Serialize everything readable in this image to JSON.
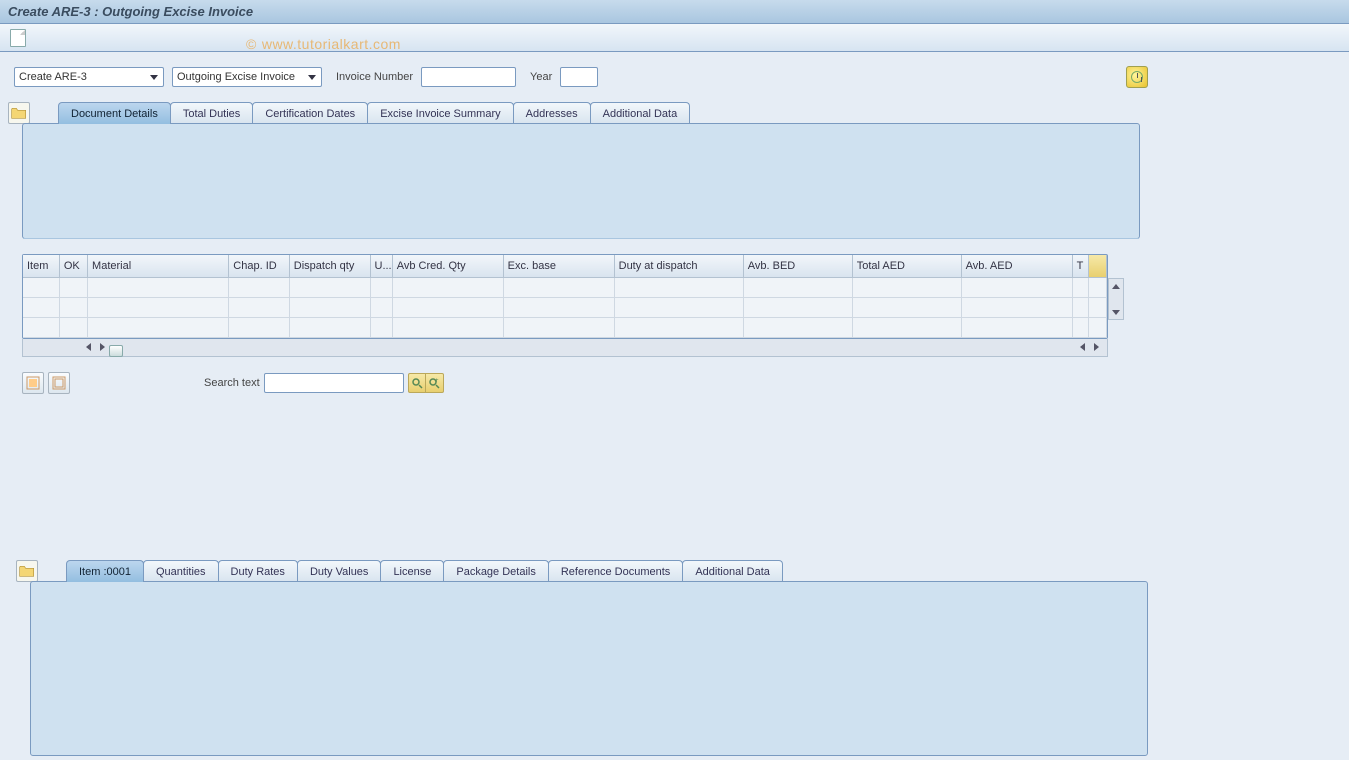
{
  "title": "Create ARE-3 : Outgoing Excise Invoice",
  "watermark": "www.tutorialkart.com",
  "filter": {
    "select1": "Create ARE-3",
    "select2": "Outgoing Excise Invoice",
    "invoice_label": "Invoice Number",
    "invoice_value": "",
    "year_label": "Year",
    "year_value": ""
  },
  "tabs1": [
    "Document Details",
    "Total Duties",
    "Certification Dates",
    "Excise Invoice Summary",
    "Addresses",
    "Additional Data"
  ],
  "tabs1_active": 0,
  "table": {
    "columns": [
      "Item",
      "OK",
      "Material",
      "Chap. ID",
      "Dispatch qty",
      "U...",
      "Avb Cred. Qty",
      "Exc. base",
      "Duty at dispatch",
      "Avb. BED",
      "Total AED",
      "Avb. AED",
      "T"
    ],
    "rows": [
      [
        "",
        "",
        "",
        "",
        "",
        "",
        "",
        "",
        "",
        "",
        "",
        "",
        ""
      ],
      [
        "",
        "",
        "",
        "",
        "",
        "",
        "",
        "",
        "",
        "",
        "",
        "",
        ""
      ],
      [
        "",
        "",
        "",
        "",
        "",
        "",
        "",
        "",
        "",
        "",
        "",
        "",
        ""
      ]
    ]
  },
  "search": {
    "label": "Search text",
    "value": ""
  },
  "tabs2": [
    "Item  :0001",
    "Quantities",
    "Duty Rates",
    "Duty Values",
    "License",
    "Package Details",
    "Reference Documents",
    "Additional Data"
  ],
  "tabs2_active": 0
}
